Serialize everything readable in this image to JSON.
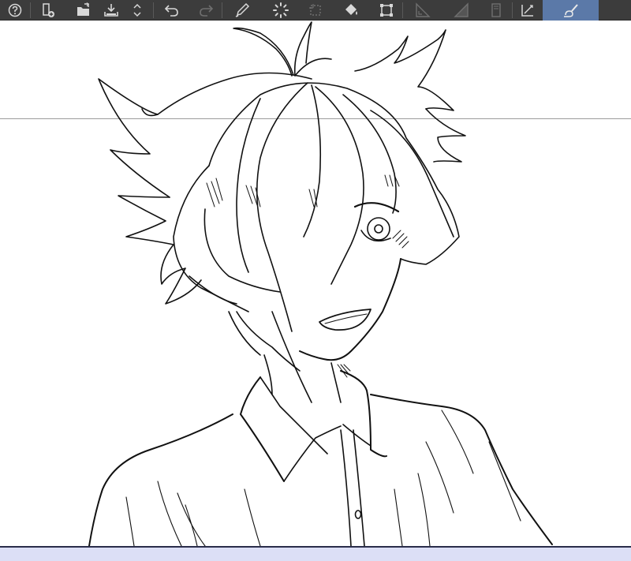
{
  "app": {
    "accent_color": "#5b79a8",
    "toolbar_bg": "#3c3c3c",
    "icon_color": "#d8d8d8",
    "disabled_icon_color": "#6f6f6f",
    "status_bar_color": "#dcdff6"
  },
  "toolbar": {
    "buttons": [
      {
        "icon": "help-icon",
        "enabled": true
      },
      {
        "icon": "new-canvas-icon",
        "enabled": true
      },
      {
        "icon": "open-folder-icon",
        "enabled": true
      },
      {
        "icon": "save-icon",
        "enabled": true
      },
      {
        "icon": "scroll-arrows-icon",
        "enabled": true
      },
      {
        "icon": "undo-icon",
        "enabled": true
      },
      {
        "icon": "redo-icon",
        "enabled": false
      },
      {
        "icon": "pen-icon",
        "enabled": true
      },
      {
        "icon": "loading-spinner-icon",
        "enabled": true
      },
      {
        "icon": "selection-icon",
        "enabled": false
      },
      {
        "icon": "fill-bucket-icon",
        "enabled": true
      },
      {
        "icon": "transform-icon",
        "enabled": true
      },
      {
        "icon": "ruler-icon",
        "enabled": false
      },
      {
        "icon": "gradient-ruler-icon",
        "enabled": false
      },
      {
        "icon": "layer-page-icon",
        "enabled": false
      },
      {
        "icon": "snap-ruler-icon",
        "enabled": true
      },
      {
        "icon": "brush-stabilizer-icon",
        "enabled": true,
        "active": true
      }
    ]
  },
  "canvas": {
    "background": "#ffffff",
    "artwork": "anime-boy-line-art"
  }
}
